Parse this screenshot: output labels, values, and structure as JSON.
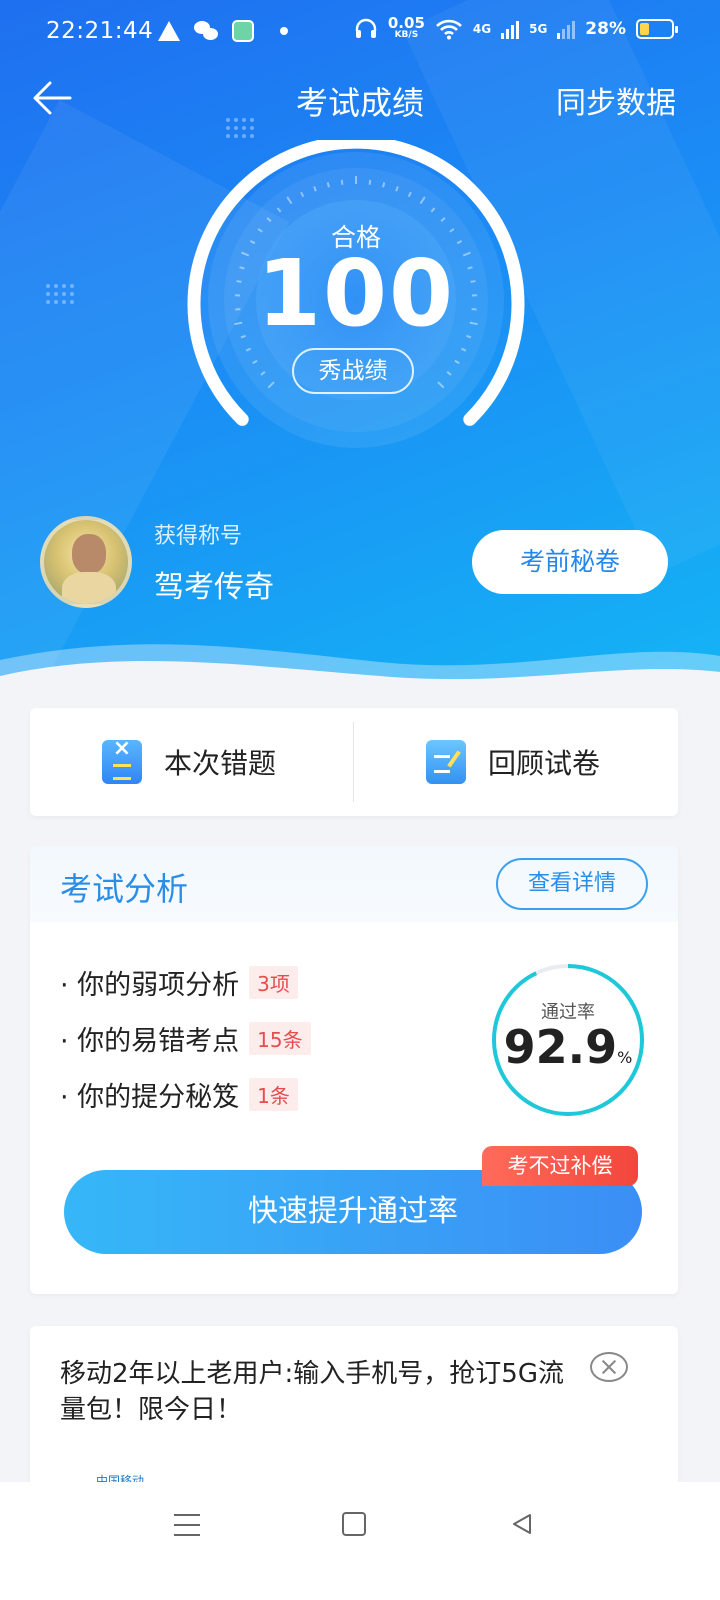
{
  "status_bar": {
    "time": "22:21:44",
    "net_speed_value": "0.05",
    "net_speed_unit": "KB/S",
    "signal1": "4G",
    "signal2": "5G",
    "battery": "28%",
    "icons": [
      "warning-icon",
      "wechat-icon",
      "app-icon",
      "dot-icon",
      "headset-icon",
      "wifi-icon",
      "battery-icon"
    ]
  },
  "header": {
    "title": "考试成绩",
    "sync_label": "同步数据"
  },
  "score": {
    "status": "合格",
    "value": "100",
    "show_label": "秀战绩"
  },
  "honor": {
    "label": "获得称号",
    "value": "驾考传奇",
    "secret_label": "考前秘卷"
  },
  "actions": {
    "wrong_label": "本次错题",
    "review_label": "回顾试卷"
  },
  "analysis": {
    "title": "考试分析",
    "detail_label": "查看详情",
    "items": [
      {
        "text": "· 你的弱项分析",
        "badge": "3项"
      },
      {
        "text": "· 你的易错考点",
        "badge": "15条"
      },
      {
        "text": "· 你的提分秘笈",
        "badge": "1条"
      }
    ],
    "rate_label": "通过率",
    "rate_value": "92.9",
    "rate_unit": "%",
    "rate_fraction": 0.929,
    "boost_label": "快速提升通过率",
    "guarantee_label": "考不过补偿"
  },
  "ad": {
    "text": "移动2年以上老用户:输入手机号，抢订5G流量包！限今日！",
    "logo_text": "中国移动"
  },
  "colors": {
    "primary": "#1f7ff0",
    "accent": "#2a8ee8",
    "badge_red": "#e84d4d",
    "ring_cyan": "#1ec8d8"
  }
}
